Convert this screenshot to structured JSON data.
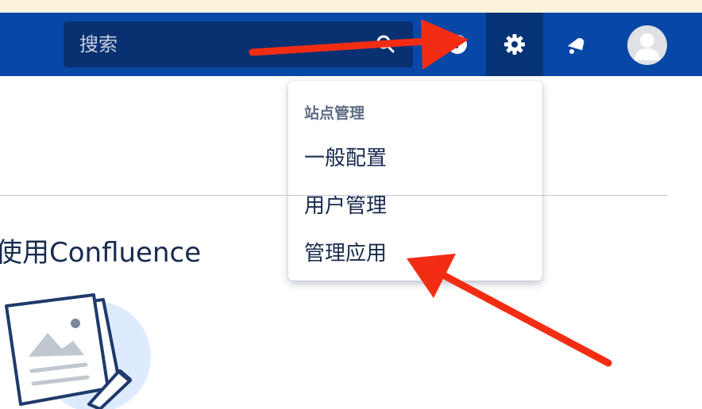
{
  "header": {
    "search": {
      "placeholder": "搜索"
    },
    "icons": [
      "search-icon",
      "help-icon",
      "gear-icon",
      "notification-icon",
      "avatar"
    ]
  },
  "dropdown": {
    "heading": "站点管理",
    "items": [
      {
        "label": "一般配置"
      },
      {
        "label": "用户管理"
      },
      {
        "label": "管理应用"
      }
    ]
  },
  "main": {
    "welcome_text": "使用Confluence"
  },
  "colors": {
    "navbar": "#0747a6",
    "search_bg": "#093071",
    "annotation_arrow": "#f32d14"
  }
}
